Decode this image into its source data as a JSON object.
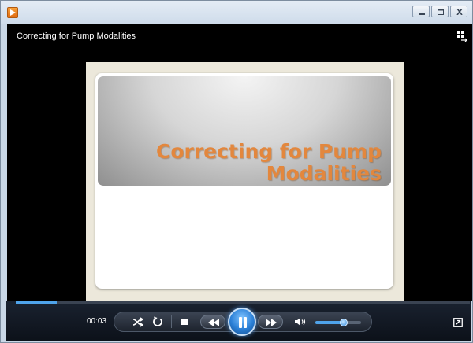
{
  "window": {
    "title": "Correcting for Pump Modalities",
    "icon": "media-player-icon",
    "controls": [
      "minimize-icon",
      "maximize-icon",
      "close-icon"
    ]
  },
  "video": {
    "slide_title": "Correcting for Pump Modalities"
  },
  "player": {
    "current_time": "00:03",
    "progress": 0.09,
    "volume": 0.62,
    "state": "playing"
  },
  "colors": {
    "accent": "#4fa3ea",
    "slide_title": "#e3873d",
    "video_bg": "#000000"
  },
  "icons": {
    "shuffle": "shuffle-icon",
    "repeat": "repeat-icon",
    "stop": "stop-icon",
    "previous": "previous-icon",
    "pause": "pause-icon",
    "next": "next-icon",
    "mute": "speaker-icon",
    "view": "switch-view-icon",
    "fullscreen": "fullscreen-toggle-icon"
  }
}
